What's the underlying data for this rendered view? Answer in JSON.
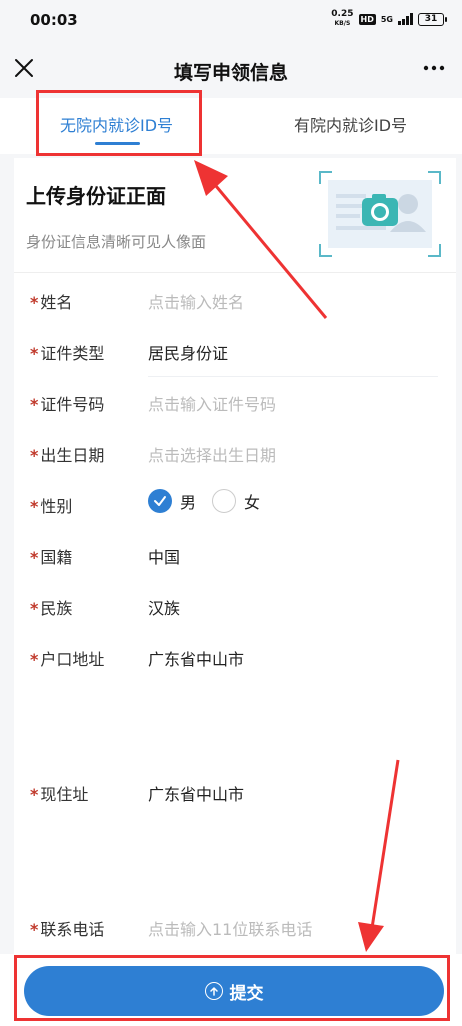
{
  "status_bar": {
    "time": "00:03",
    "net_speed_value": "0.25",
    "net_speed_unit": "KB/S",
    "hd": "HD",
    "network": "5G",
    "battery": "31"
  },
  "nav": {
    "title": "填写申领信息",
    "close_icon": "close-icon",
    "more_icon": "more-icon"
  },
  "tabs": [
    {
      "label": "无院内就诊ID号",
      "active": true
    },
    {
      "label": "有院内就诊ID号",
      "active": false
    }
  ],
  "upload": {
    "title": "上传身份证正面",
    "subtitle": "身份证信息清晰可见人像面",
    "icon": "camera-icon"
  },
  "form": {
    "required_mark": "*",
    "name_label": "姓名",
    "name_placeholder": "点击输入姓名",
    "id_type_label": "证件类型",
    "id_type_value": "居民身份证",
    "id_number_label": "证件号码",
    "id_number_placeholder": "点击输入证件号码",
    "birth_label": "出生日期",
    "birth_placeholder": "点击选择出生日期",
    "gender_label": "性别",
    "gender_male": "男",
    "gender_female": "女",
    "gender_selected": "男",
    "nationality_label": "国籍",
    "nationality_value": "中国",
    "ethnicity_label": "民族",
    "ethnicity_value": "汉族",
    "household_label": "户口地址",
    "household_value": "广东省中山市",
    "current_addr_label": "现住址",
    "current_addr_value": "广东省中山市",
    "phone_label": "联系电话",
    "phone_placeholder": "点击输入11位联系电话"
  },
  "submit": {
    "label": "提交",
    "icon": "upload-arrow-icon"
  },
  "colors": {
    "accent": "#2e7fd3",
    "annotation": "#e33333"
  }
}
